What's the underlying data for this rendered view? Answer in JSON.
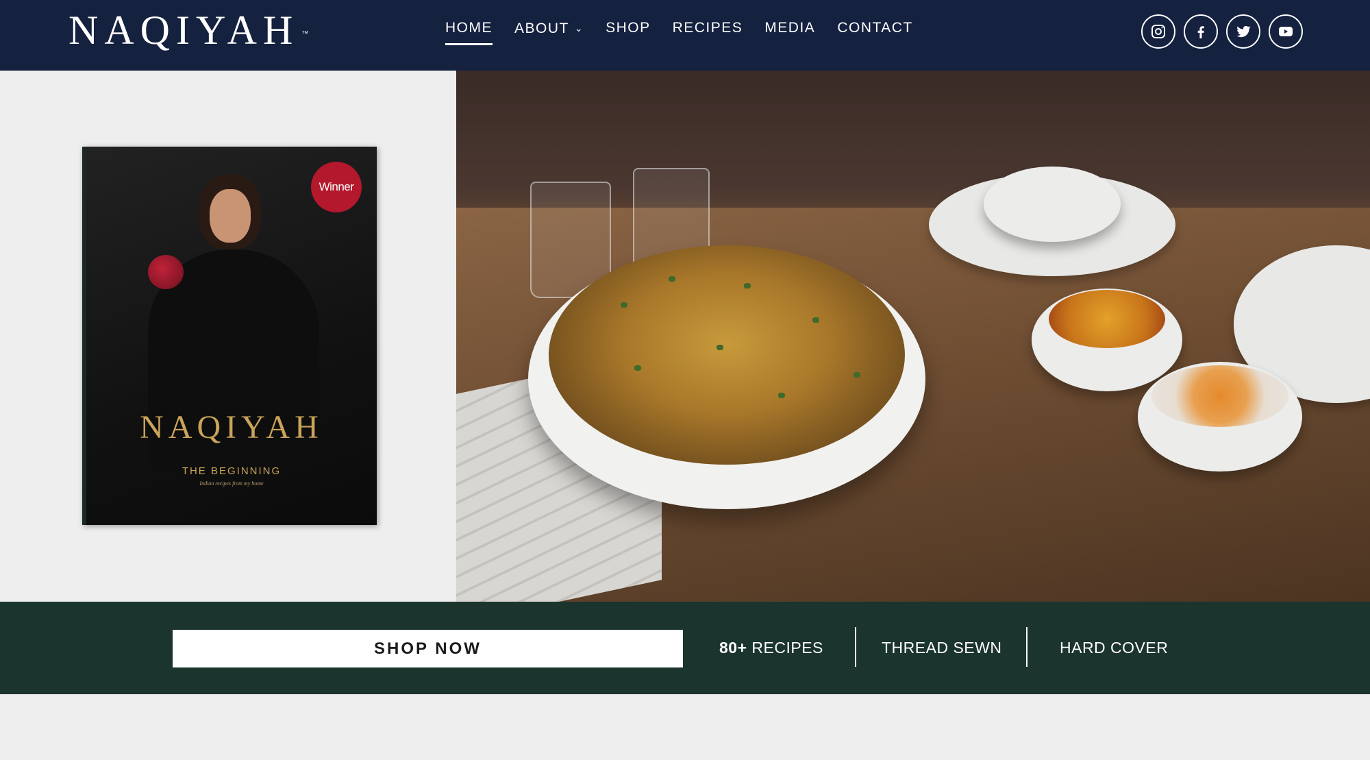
{
  "header": {
    "logo": "NAQIYAH",
    "logo_tm": "™",
    "nav": [
      {
        "label": "HOME",
        "active": true
      },
      {
        "label": "ABOUT",
        "has_dropdown": true
      },
      {
        "label": "SHOP"
      },
      {
        "label": "RECIPES"
      },
      {
        "label": "MEDIA"
      },
      {
        "label": "CONTACT"
      }
    ],
    "socials": [
      "instagram-icon",
      "facebook-icon",
      "twitter-icon",
      "youtube-icon"
    ]
  },
  "book": {
    "badge": "Winner",
    "title": "NAQIYAH",
    "subtitle": "THE BEGINNING",
    "tagline": "Indian recipes from my home"
  },
  "strip": {
    "shop_button": "SHOP NOW",
    "features": {
      "recipes_count": "80+",
      "recipes_label": "RECIPES",
      "thread": "THREAD SEWN",
      "cover": "HARD COVER"
    }
  },
  "colors": {
    "header_bg": "#14213f",
    "strip_bg": "#1b342e",
    "page_bg": "#eeeeee",
    "book_gold": "#c9a45a",
    "badge_red": "#b3182c"
  }
}
